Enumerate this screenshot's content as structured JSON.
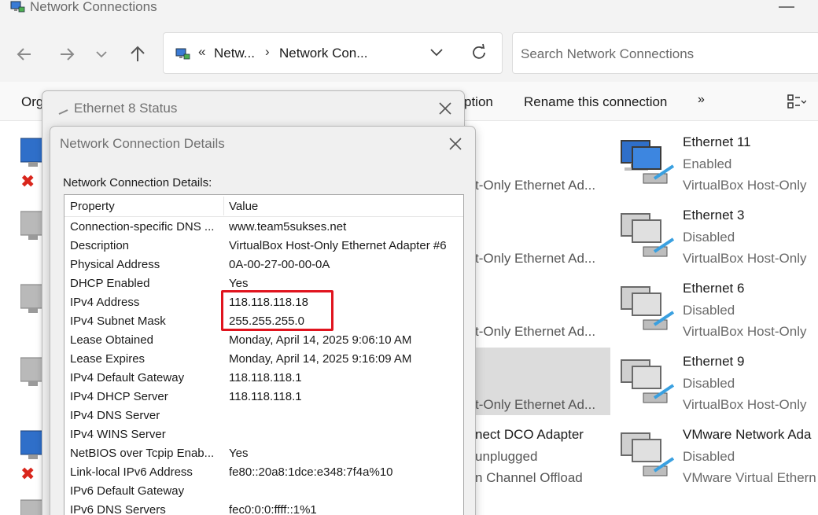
{
  "window": {
    "title": "Network Connections"
  },
  "address": {
    "chevron": "«",
    "crumbs": [
      "Netw...",
      "Network Con..."
    ],
    "sep": "›"
  },
  "search": {
    "placeholder": "Search Network Connections"
  },
  "toolbar": {
    "organize": "Org",
    "partial": "ption",
    "rename": "Rename this connection",
    "more": "»"
  },
  "middle_items": [
    {
      "name": "",
      "status": "",
      "device": "t-Only Ethernet Ad..."
    },
    {
      "name": "",
      "status": "",
      "device": "t-Only Ethernet Ad..."
    },
    {
      "name": "",
      "status": "",
      "device": "t-Only Ethernet Ad..."
    },
    {
      "name": "",
      "status": "",
      "device": "t-Only Ethernet Ad..."
    },
    {
      "name": "nect DCO Adapter",
      "status": "unplugged",
      "device": "n Channel Offload"
    }
  ],
  "connections": [
    {
      "name": "Ethernet 11",
      "status": "Enabled",
      "device": "VirtualBox Host-Only"
    },
    {
      "name": "Ethernet 3",
      "status": "Disabled",
      "device": "VirtualBox Host-Only"
    },
    {
      "name": "Ethernet 6",
      "status": "Disabled",
      "device": "VirtualBox Host-Only"
    },
    {
      "name": "Ethernet 9",
      "status": "Disabled",
      "device": "VirtualBox Host-Only"
    },
    {
      "name": "VMware Network Ada",
      "status": "Disabled",
      "device": "VMware Virtual Ethern"
    }
  ],
  "status_dialog": {
    "title": "Ethernet 8 Status"
  },
  "details_dialog": {
    "title": "Network Connection Details",
    "label": "Network Connection Details:",
    "headers": {
      "property": "Property",
      "value": "Value"
    },
    "rows": [
      {
        "property": "Connection-specific DNS ...",
        "value": "www.team5sukses.net"
      },
      {
        "property": "Description",
        "value": "VirtualBox Host-Only Ethernet Adapter #6"
      },
      {
        "property": "Physical Address",
        "value": "0A-00-27-00-00-0A"
      },
      {
        "property": "DHCP Enabled",
        "value": "Yes"
      },
      {
        "property": "IPv4 Address",
        "value": "118.118.118.18"
      },
      {
        "property": "IPv4 Subnet Mask",
        "value": "255.255.255.0"
      },
      {
        "property": "Lease Obtained",
        "value": "Monday, April 14, 2025 9:06:10 AM"
      },
      {
        "property": "Lease Expires",
        "value": "Monday, April 14, 2025 9:16:09 AM"
      },
      {
        "property": "IPv4 Default Gateway",
        "value": "118.118.118.1"
      },
      {
        "property": "IPv4 DHCP Server",
        "value": "118.118.118.1"
      },
      {
        "property": "IPv4 DNS Server",
        "value": ""
      },
      {
        "property": "IPv4 WINS Server",
        "value": ""
      },
      {
        "property": "NetBIOS over Tcpip Enab...",
        "value": "Yes"
      },
      {
        "property": "Link-local IPv6 Address",
        "value": "fe80::20a8:1dce:e348:7f4a%10"
      },
      {
        "property": "IPv6 Default Gateway",
        "value": ""
      },
      {
        "property": "IPv6 DNS Servers",
        "value": "fec0:0:0:ffff::1%1"
      }
    ]
  },
  "colors": {
    "highlight": "#e0141e",
    "selection": "#dcdcdc",
    "error": "#d9261c"
  }
}
